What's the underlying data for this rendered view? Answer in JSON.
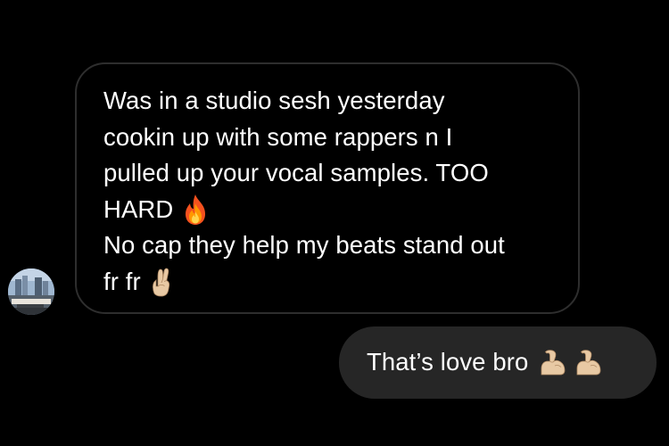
{
  "incoming": {
    "lines": [
      "Was in a studio sesh yesterday",
      "cookin up with some rappers n I",
      "pulled up your vocal samples. TOO",
      "HARD",
      "No cap they help my beats stand out",
      "fr fr"
    ],
    "emojis": [
      "fire-emoji",
      "crossed-fingers-emoji"
    ]
  },
  "outgoing": {
    "text": "That’s love bro",
    "emojis": [
      "flexed-biceps-emoji",
      "flexed-biceps-emoji"
    ]
  },
  "colors": {
    "background": "#000000",
    "incoming_bubble_border": "#2e2e2e",
    "outgoing_bubble_fill": "#262626",
    "text": "#ffffff"
  }
}
